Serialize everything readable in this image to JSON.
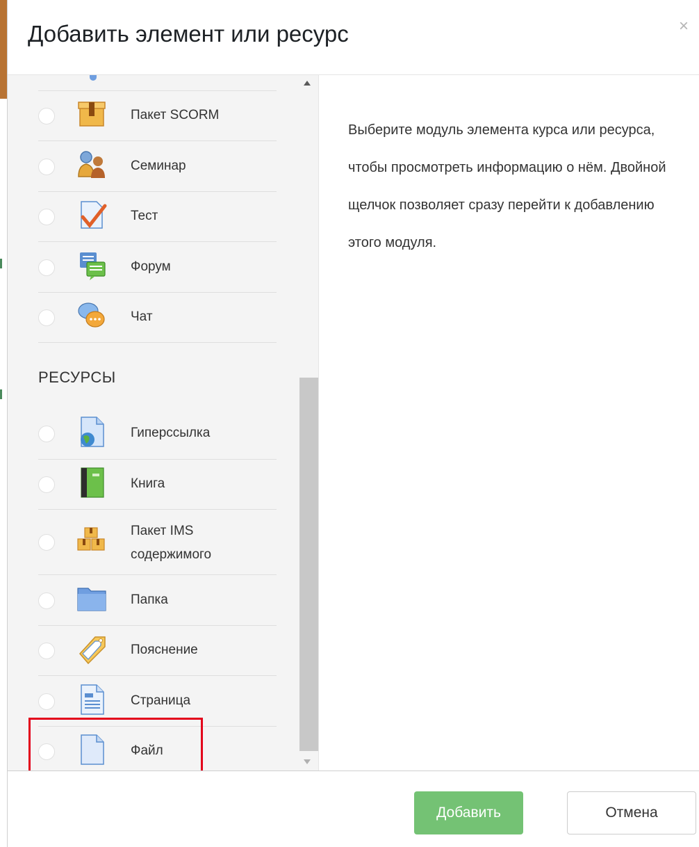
{
  "dialog": {
    "title": "Добавить элемент или ресурс",
    "close_glyph": "×"
  },
  "activities": [
    {
      "label": "Пакет SCORM",
      "icon": "scorm-package-icon"
    },
    {
      "label": "Семинар",
      "icon": "workshop-icon"
    },
    {
      "label": "Тест",
      "icon": "quiz-icon"
    },
    {
      "label": "Форум",
      "icon": "forum-icon"
    },
    {
      "label": "Чат",
      "icon": "chat-icon"
    }
  ],
  "resources_heading": "РЕСУРСЫ",
  "resources": [
    {
      "label": "Гиперссылка",
      "icon": "url-icon"
    },
    {
      "label": "Книга",
      "icon": "book-icon"
    },
    {
      "label_line1": "Пакет IMS",
      "label_line2": "содержимого",
      "icon": "ims-package-icon"
    },
    {
      "label": "Папка",
      "icon": "folder-icon"
    },
    {
      "label": "Пояснение",
      "icon": "label-tag-icon"
    },
    {
      "label": "Страница",
      "icon": "page-icon"
    },
    {
      "label": "Файл",
      "icon": "file-icon"
    }
  ],
  "description": "Выберите модуль элемента курса или ресурса, чтобы просмотреть информацию о нём. Двойной щелчок позволяет сразу перейти к добавлению этого модуля.",
  "footer": {
    "add_label": "Добавить",
    "cancel_label": "Отмена"
  },
  "colors": {
    "accent": "#5cb85c",
    "highlight": "#e3001b",
    "header_accent": "#b87333"
  }
}
